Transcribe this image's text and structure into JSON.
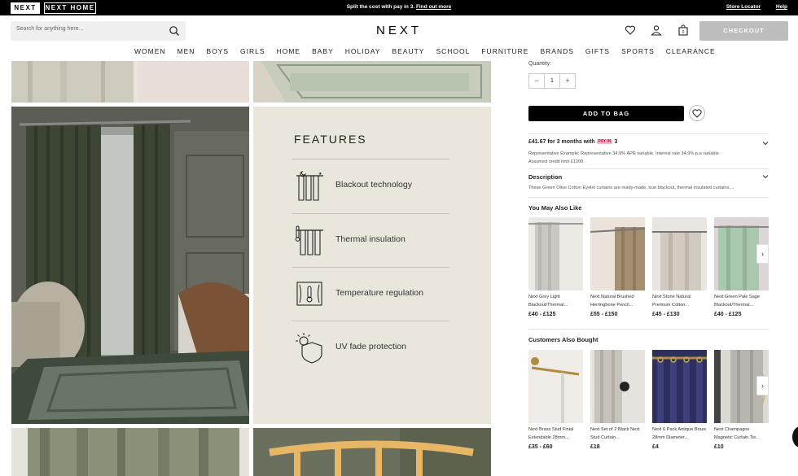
{
  "topbar": {
    "brand_next": "NEXT",
    "brand_home": "NEXT HOME",
    "promo_text": "Split the cost with pay in 3.",
    "promo_link": "Find out more",
    "store_locator": "Store Locator",
    "help": "Help"
  },
  "header": {
    "search_placeholder": "Search for anything here...",
    "logo": "NEXT",
    "checkout": "CHECKOUT"
  },
  "nav": [
    "WOMEN",
    "MEN",
    "BOYS",
    "GIRLS",
    "HOME",
    "BABY",
    "HOLIDAY",
    "BEAUTY",
    "SCHOOL",
    "FURNITURE",
    "BRANDS",
    "GIFTS",
    "SPORTS",
    "CLEARANCE"
  ],
  "features": {
    "title": "FEATURES",
    "items": [
      {
        "label": "Blackout technology",
        "icon": "blackout-icon"
      },
      {
        "label": "Thermal insulation",
        "icon": "thermal-icon"
      },
      {
        "label": "Temperature regulation",
        "icon": "temperature-icon"
      },
      {
        "label": "UV fade protection",
        "icon": "uv-icon"
      }
    ]
  },
  "product": {
    "quantity_label": "Quantity:",
    "quantity_value": "1",
    "add_to_bag": "ADD TO BAG",
    "pay_title": "£41.67 for 3 months with",
    "pay_badge": "PAY IN",
    "pay_num": "3",
    "pay_rep": "Representative Example: Representative 34.9% APR variable. Interest rate 34.9% p.a variable.",
    "pay_credit": "Assumed credit limit £1200.",
    "description_title": "Description",
    "description_text": "These Green Olive Cotton Eyelet curtains are ready-made, true blackout, thermal insulated curtains,..."
  },
  "you_may_also_like": {
    "title": "You May Also Like",
    "items": [
      {
        "name": "Next Grey Light Blackout/Thermal...",
        "price": "£40 - £125"
      },
      {
        "name": "Next Natural Brushed Herringbone Pencil...",
        "price": "£55 - £150"
      },
      {
        "name": "Next Stone Natural Premium Cotton...",
        "price": "£45 - £130"
      },
      {
        "name": "Next Green Pale Sage Blackout/Thermal...",
        "price": "£40 - £125"
      }
    ]
  },
  "customers_also_bought": {
    "title": "Customers Also Bought",
    "items": [
      {
        "name": "Next Brass Stud Finial Extendable 28mm...",
        "price": "£35 - £60"
      },
      {
        "name": "Next Set of 2 Black Next Stud Curtain...",
        "price": "£18"
      },
      {
        "name": "Next 6 Pack Antique Brass 28mm Diameter...",
        "price": "£4"
      },
      {
        "name": "Next Champagne Magnetic Curtain Tie...",
        "price": "£10"
      }
    ]
  },
  "colors": {
    "accent_black": "#000000",
    "checkout_grey": "#bdbdbd",
    "features_bg": "#ebe6dc",
    "curtain_green": "#3d4535"
  }
}
